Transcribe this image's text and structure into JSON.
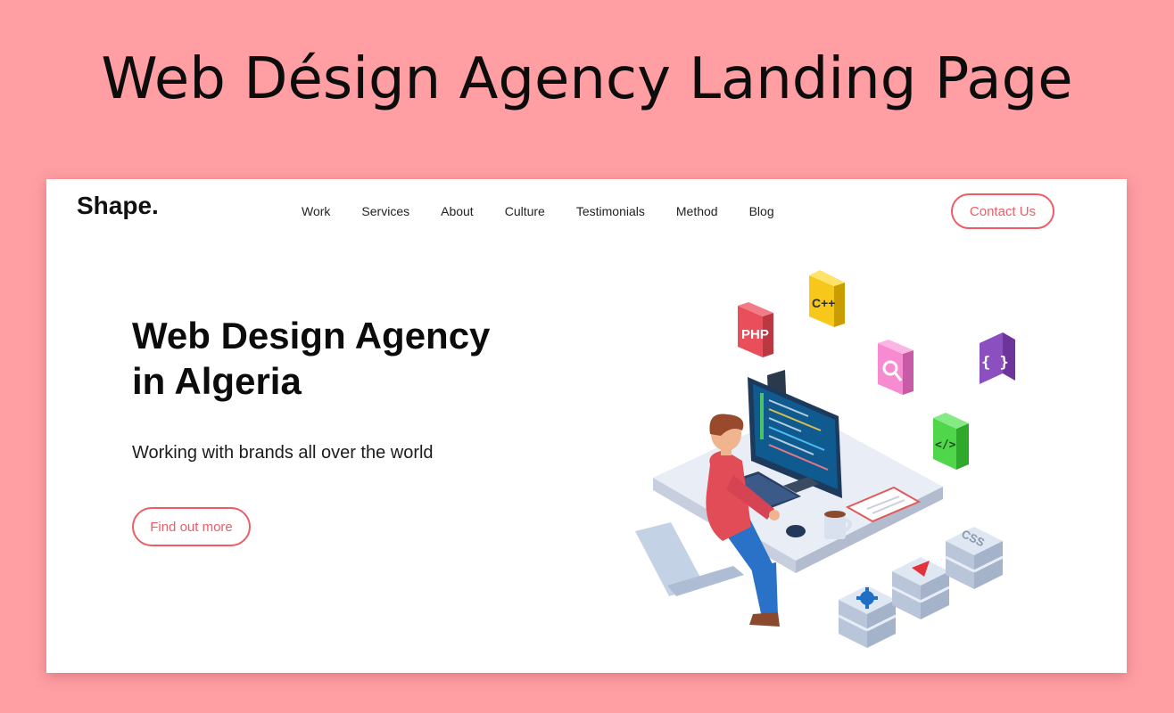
{
  "banner": {
    "title": "Web Désign Agency Landing Page"
  },
  "header": {
    "logo": "Shape.",
    "nav": [
      "Work",
      "Services",
      "About",
      "Culture",
      "Testimonials",
      "Method",
      "Blog"
    ],
    "contact_label": "Contact Us"
  },
  "hero": {
    "title_line1": "Web Design Agency",
    "title_line2": "in Algeria",
    "subtitle": "Working with brands all over the world",
    "cta_label": "Find out more"
  },
  "illustration": {
    "tiles": {
      "php": "PHP",
      "cpp": "C++",
      "braces": "{ }",
      "code": "</>",
      "css": "CSS"
    }
  },
  "colors": {
    "background": "#ff9ea3",
    "accent": "#ee5d66",
    "php_tile": "#e94e5b",
    "cpp_tile": "#f7c81b",
    "search_tile": "#f78bd2",
    "braces_tile": "#8c4fc0",
    "code_tile": "#4fd64b"
  },
  "icons": [
    "search-icon",
    "gear-icon",
    "play-triangle-icon"
  ]
}
